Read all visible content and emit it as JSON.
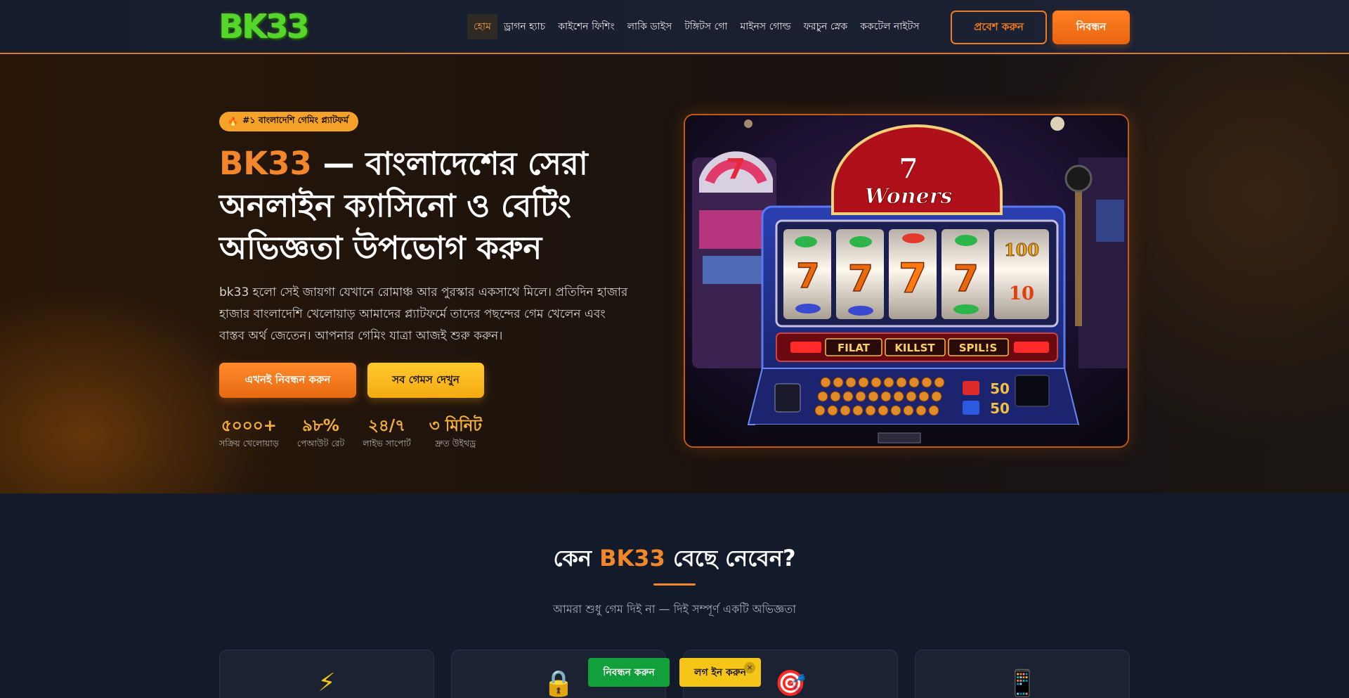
{
  "header": {
    "logo": "BK33",
    "nav": [
      "হোম",
      "ড্রাগন হ্যাচ",
      "কাইশেন ফিশিং",
      "লাকি ডাইস",
      "টঙ্গিটস গো",
      "মাইনস গোল্ড",
      "ফরচুন স্নেক",
      "ককটেল নাইটস"
    ],
    "login_label": "প্রবেশ করুন",
    "register_label": "নিবন্ধন"
  },
  "hero": {
    "badge": "#১ বাংলাদেশি গেমিং প্ল্যাটফর্ম",
    "badge_icon": "fire-icon",
    "title_brand": "BK33",
    "title_rest": " — বাংলাদেশের সেরা অনলাইন ক্যাসিনো ও বেটিং অভিজ্ঞতা উপভোগ করুন",
    "description": "bk33 হলো সেই জায়গা যেখানে রোমাঞ্চ আর পুরস্কার একসাথে মিলে। প্রতিদিন হাজার হাজার বাংলাদেশি খেলোয়াড় আমাদের প্ল্যাটফর্মে তাদের পছন্দের গেম খেলেন এবং বাস্তব অর্থ জেতেন। আপনার গেমিং যাত্রা আজই শুরু করুন।",
    "primary_button": "এখনই নিবন্ধন করুন",
    "secondary_button": "সব গেমস দেখুন",
    "stats": [
      {
        "value": "৫০০০+",
        "label": "সক্রিয় খেলোয়াড়"
      },
      {
        "value": "৯৮%",
        "label": "পেআউট রেট"
      },
      {
        "value": "২৪/৭",
        "label": "লাইভ সাপোর্ট"
      },
      {
        "value": "৩ মিনিট",
        "label": "দ্রুত উইথড্র"
      }
    ],
    "slot_image": {
      "sign": "Woners",
      "reels": [
        "7",
        "7",
        "7",
        "7",
        "100"
      ],
      "buttons": [
        "FILAT",
        "KILLST",
        "SPIL!S"
      ],
      "credit": "50"
    }
  },
  "why": {
    "title_prefix": "কেন ",
    "title_brand": "BK33",
    "title_suffix": " বেছে নেবেন?",
    "subtitle": "আমরা শুধু গেম দিই না — দিই সম্পূর্ণ একটি অভিজ্ঞতা",
    "cards": [
      {
        "icon": "⚡",
        "icon_name": "lightning-icon"
      },
      {
        "icon": "🔒",
        "icon_name": "lock-icon"
      },
      {
        "icon": "🎯",
        "icon_name": "target-icon"
      },
      {
        "icon": "📱",
        "icon_name": "mobile-phone-icon"
      }
    ]
  },
  "floating": {
    "register_label": "নিবন্ধন করুন",
    "login_label": "লগ ইন করুন",
    "close_symbol": "×"
  },
  "colors": {
    "accent_orange": "#f2862a",
    "accent_yellow": "#f5b03a",
    "logo_green": "#55d62a",
    "float_green": "#12a03a",
    "float_yellow": "#f5c518"
  }
}
